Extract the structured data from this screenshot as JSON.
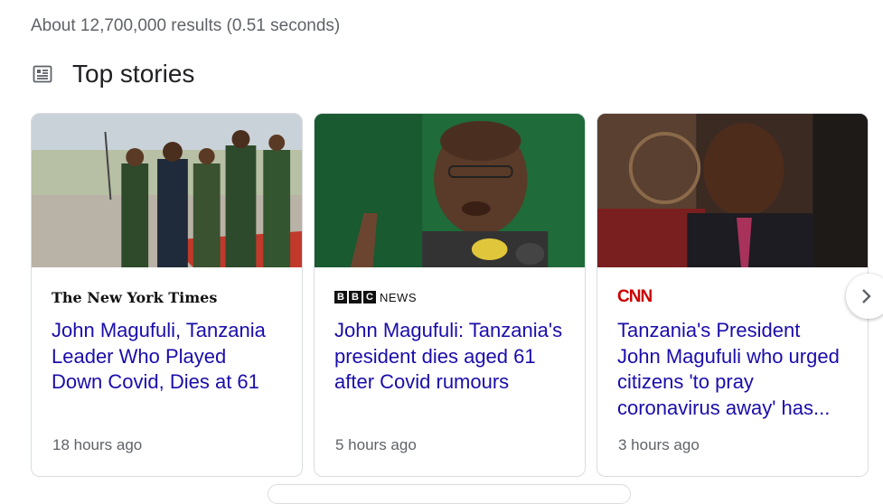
{
  "results_stats": "About 12,700,000 results (0.51 seconds)",
  "section": {
    "title": "Top stories",
    "icon": "newspaper-icon"
  },
  "stories": [
    {
      "source": "The New York Times",
      "title": "John Magufuli, Tanzania Leader Who Played Down Covid, Dies at 61",
      "time": "18 hours ago"
    },
    {
      "source_bbc": [
        "B",
        "B",
        "C"
      ],
      "source_news": "NEWS",
      "title": "John Magufuli: Tanzania's president dies aged 61 after Covid rumours",
      "time": "5 hours ago"
    },
    {
      "source": "CNN",
      "title": "Tanzania's President John Magufuli who urged citizens 'to pray coronavirus away' has...",
      "time": "3 hours ago"
    }
  ],
  "colors": {
    "link": "#1a0dab",
    "secondary_text": "#5f6368",
    "cnn_red": "#cc0000"
  }
}
